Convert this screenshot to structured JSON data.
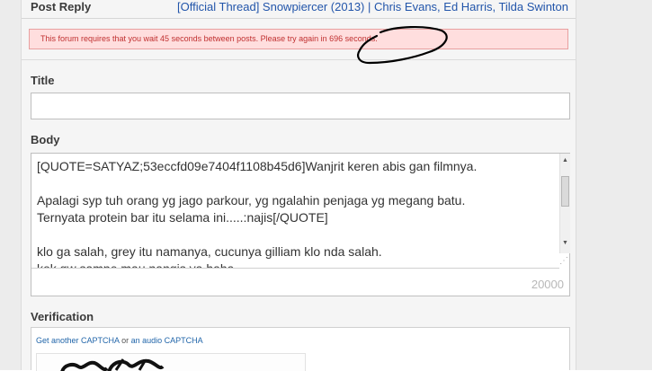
{
  "header": {
    "title": "Post Reply",
    "thread_link": "[Official Thread] Snowpiercer (2013) | Chris Evans, Ed Harris, Tilda Swinton"
  },
  "error_message": "This forum requires that you wait 45 seconds between posts. Please try again in 696 seconds.",
  "form": {
    "title_label": "Title",
    "title_value": "",
    "body_label": "Body",
    "body_value": "[QUOTE=SATYAZ;53eccfd09e7404f1108b45d6]Wanjrit keren abis gan filmnya.\n\nApalagi syp tuh orang yg jago parkour, yg ngalahin penjaga yg megang batu.\nTernyata protein bar itu selama ini.....:najis[/QUOTE]\n\nklo ga salah, grey itu namanya, cucunya gilliam klo nda salah.\nkok gw sampe mau nangis ya haha",
    "char_counter": "20000",
    "verification_label": "Verification",
    "captcha_link_1": "Get another CAPTCHA",
    "captcha_or": "or",
    "captcha_link_2": "an audio CAPTCHA"
  },
  "colors": {
    "link": "#2255aa",
    "error_bg": "#ffdede",
    "error_text": "#c03030",
    "annotation": "#000000"
  },
  "icons": {
    "scroll_up": "triangle-up",
    "scroll_down": "triangle-down",
    "resize": "resize-grip"
  }
}
